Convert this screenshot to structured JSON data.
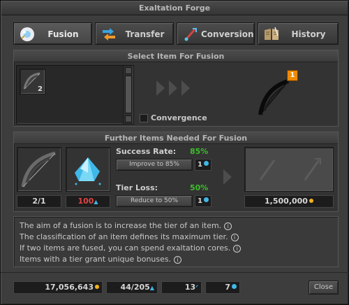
{
  "window": {
    "title": "Exaltation Forge"
  },
  "tabs": [
    {
      "label": "Fusion",
      "icon": "fusion-icon",
      "active": true
    },
    {
      "label": "Transfer",
      "icon": "transfer-icon",
      "active": false
    },
    {
      "label": "Conversion",
      "icon": "conversion-icon",
      "active": false
    },
    {
      "label": "History",
      "icon": "history-book-icon",
      "active": false
    }
  ],
  "select_item": {
    "header": "Select Item For Fusion",
    "items": [
      {
        "name": "bow",
        "count": "2"
      }
    ],
    "result_tier": "1",
    "convergence_label": "Convergence",
    "convergence_checked": false
  },
  "further_items": {
    "header": "Further Items Needed For Fusion",
    "bow_count": "2/1",
    "dust_count": "100",
    "success_rate": {
      "label": "Success Rate:",
      "value": "85%",
      "button": "Improve to 85%",
      "cost": "1"
    },
    "tier_loss": {
      "label": "Tier Loss:",
      "value": "50%",
      "button": "Reduce to 50%",
      "cost": "1"
    },
    "price": "1,500,000"
  },
  "info": {
    "lines": [
      "The aim of a fusion is to increase the tier of an item.",
      "The classification of an item defines its maximum tier.",
      "If two items are fused, you can spend exaltation cores.",
      "Items with a tier grant unique bonuses."
    ]
  },
  "footer": {
    "gold": "17,056,643",
    "dust": "44/205",
    "slivers": "13",
    "cores": "7",
    "close_label": "Close"
  },
  "colors": {
    "green": "#3dbd2c",
    "red": "#e04545",
    "gold": "#f3b21c",
    "cyan": "#3fb8e8",
    "tier_badge": "#f08a00"
  }
}
